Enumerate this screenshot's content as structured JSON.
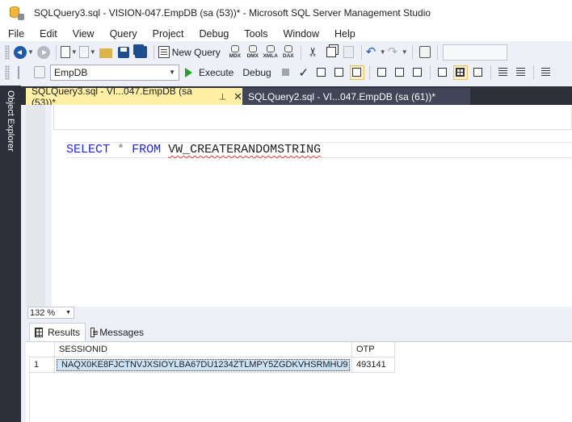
{
  "window": {
    "title": "SQLQuery3.sql - VISION-047.EmpDB (sa (53))* - Microsoft SQL Server Management Studio"
  },
  "menu": [
    "File",
    "Edit",
    "View",
    "Query",
    "Project",
    "Debug",
    "Tools",
    "Window",
    "Help"
  ],
  "toolbar": {
    "new_query_label": "New Query",
    "mdx_label": "MDX",
    "dmx_label": "DMX",
    "xmla_label": "XMLA",
    "dax_label": "DAX",
    "database_value": "EmpDB",
    "execute_label": "Execute",
    "debug_label": "Debug"
  },
  "sidebar": {
    "object_explorer_label": "Object Explorer"
  },
  "tabs": [
    {
      "label": "SQLQuery3.sql - VI...047.EmpDB (sa (53))*",
      "active": true
    },
    {
      "label": "SQLQuery2.sql - VI...047.EmpDB (sa (61))*",
      "active": false
    }
  ],
  "editor": {
    "keyword_select": "SELECT",
    "operator_star": "*",
    "keyword_from": "FROM",
    "identifier": "VW_CREATERANDOMSTRING"
  },
  "zoom": {
    "value": "132 %"
  },
  "results": {
    "tabs": [
      "Results",
      "Messages"
    ],
    "columns": [
      "SESSIONID",
      "OTP"
    ],
    "rows": [
      {
        "num": "1",
        "SESSIONID": "NAQX0KE8FJCTNVJXSIOYLBA67DU1234ZTLMPY5ZGDKVHSRMHU9",
        "OTP": "493141"
      }
    ]
  },
  "colors": {
    "accent_tab": "#fff0a6",
    "dark_chrome": "#2d2f3a",
    "keyword": "#1e22ff",
    "selection": "#cde4f7",
    "execute_green": "#2e9b2e"
  }
}
